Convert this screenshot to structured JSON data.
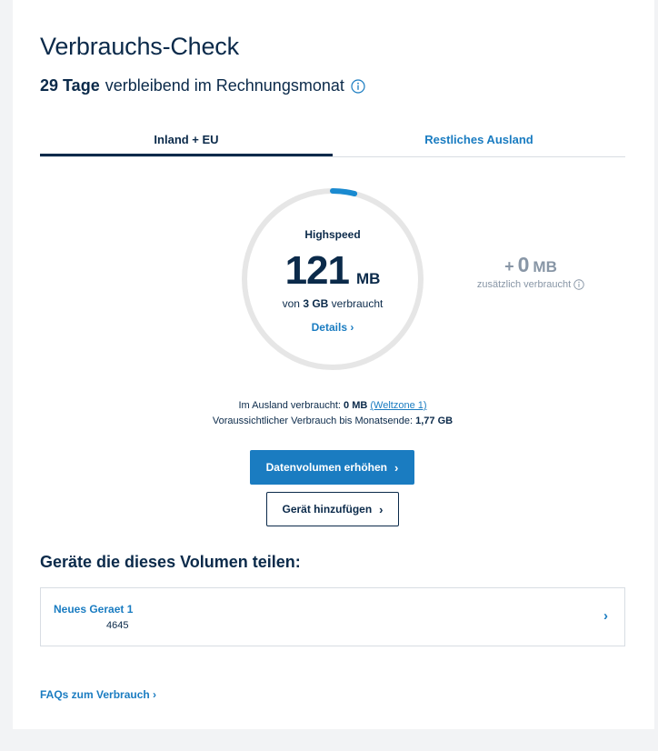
{
  "header": {
    "title": "Verbrauchs-Check",
    "days_count": "29 Tage",
    "days_text": "verbleibend im Rechnungsmonat"
  },
  "tabs": [
    {
      "label": "Inland + EU",
      "active": true
    },
    {
      "label": "Restliches Ausland",
      "active": false
    }
  ],
  "gauge": {
    "label": "Highspeed",
    "value": "121",
    "unit": "MB",
    "sub_prefix": "von",
    "sub_total": "3 GB",
    "sub_suffix": "verbraucht",
    "details": "Details",
    "used_fraction": 0.04,
    "track_color": "#e6e6e6",
    "fill_color": "#1a8ad0"
  },
  "extra": {
    "plus": "+",
    "value": "0",
    "unit": "MB",
    "label": "zusätzlich verbraucht"
  },
  "summary": {
    "abroad_label": "Im Ausland verbraucht:",
    "abroad_value": "0 MB",
    "abroad_link": "(Weltzone 1)",
    "forecast_label": "Voraussichtlicher Verbrauch bis Monatsende:",
    "forecast_value": "1,77 GB"
  },
  "buttons": {
    "increase": "Datenvolumen erhöhen",
    "add_device": "Gerät hinzufügen"
  },
  "devices": {
    "title": "Geräte die dieses Volumen teilen:",
    "items": [
      {
        "name": "Neues Geraet 1",
        "id": "4645"
      }
    ]
  },
  "faq": {
    "label": "FAQs zum Verbrauch"
  },
  "colors": {
    "accent": "#1a7cc1",
    "text": "#0b2a4a",
    "muted": "#8896a6"
  }
}
